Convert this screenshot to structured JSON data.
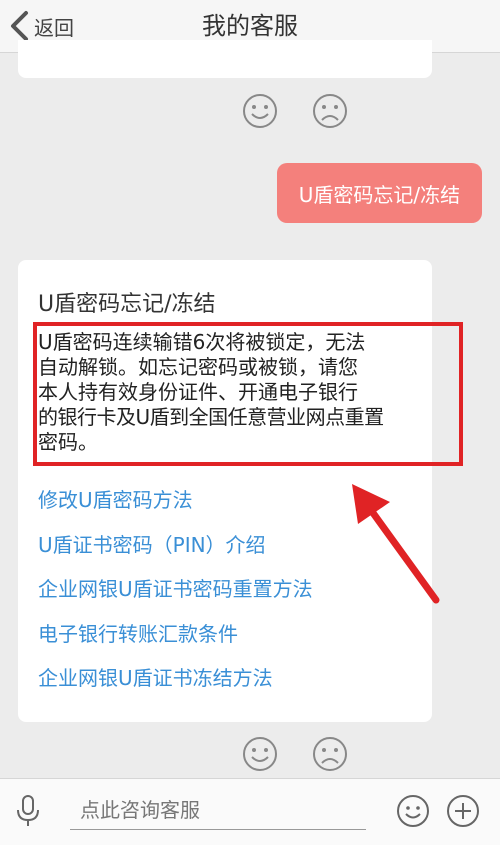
{
  "header": {
    "back_label": "返回",
    "title": "我的客服"
  },
  "user_message": "U盾密码忘记/冻结",
  "answer": {
    "title": "U盾密码忘记/冻结",
    "body_lines": [
      "U盾密码连续输错6次将被锁定，无法",
      "自动解锁。如忘记密码或被锁，请您",
      "本人持有效身份证件、开通电子银行",
      "的银行卡及U盾到全国任意营业网点重置",
      "密码。"
    ],
    "links": [
      "修改U盾密码方法",
      "U盾证书密码（PIN）介绍",
      "企业网银U盾证书密码重置方法",
      "电子银行转账汇款条件",
      "企业网银U盾证书冻结方法"
    ]
  },
  "input": {
    "placeholder": "点此咨询客服"
  },
  "colors": {
    "accent_link": "#3a8fd6",
    "user_bubble": "#f4807c",
    "highlight_border": "#e02325"
  },
  "icons": {
    "back": "chevron-left-icon",
    "like": "smile-face-icon",
    "dislike": "sad-face-icon",
    "mic": "microphone-icon",
    "emoji": "emoji-icon",
    "plus": "plus-icon"
  }
}
